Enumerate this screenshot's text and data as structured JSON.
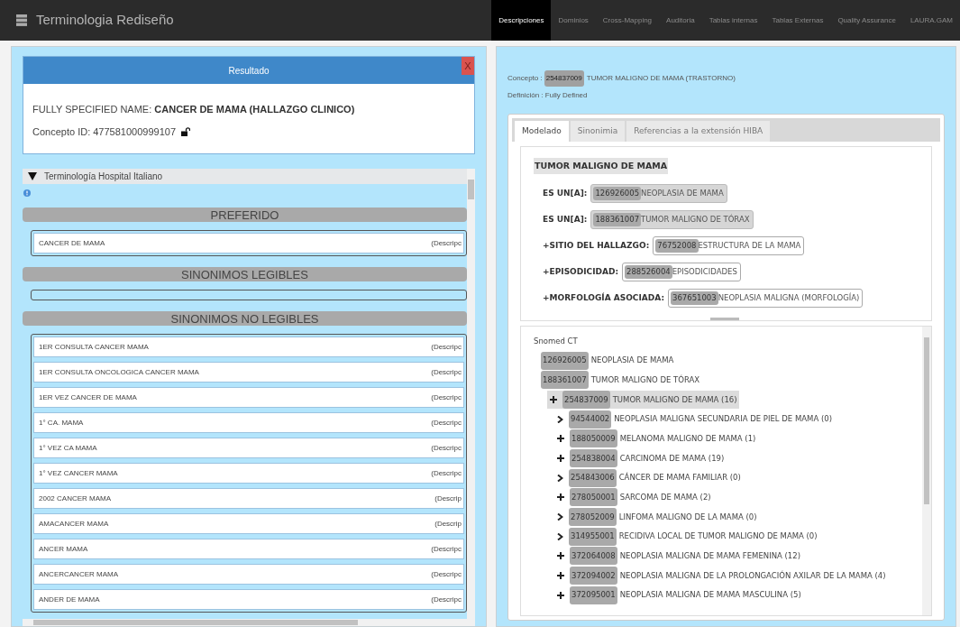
{
  "app": {
    "title": "Terminologia Rediseño"
  },
  "nav": [
    {
      "label": "Descripciones",
      "selected": true
    },
    {
      "label": "Dominios",
      "selected": false
    },
    {
      "label": "Cross-Mapping",
      "selected": false
    },
    {
      "label": "Auditoria",
      "selected": false
    },
    {
      "label": "Tablas internas",
      "selected": false
    },
    {
      "label": "Tablas Externas",
      "selected": false
    },
    {
      "label": "Quality Assurance",
      "selected": false
    },
    {
      "label": "LAURA.GAM",
      "selected": false
    }
  ],
  "result": {
    "title": "Resultado",
    "close": "X",
    "fsn_label": "FULLY SPECIFIED NAME:",
    "fsn": "CANCER DE MAMA (HALLAZGO CLINICO)",
    "concept_id": "Concepto ID: 477581000999107",
    "locked": false
  },
  "terminology": {
    "title": "Terminología Hospital Italiano",
    "expanded": true,
    "sections": [
      {
        "title": "PREFERIDO",
        "rows": [
          {
            "text": "CANCER DE MAMA",
            "type": "(Descripc"
          }
        ]
      },
      {
        "title": "SINONIMOS LEGIBLES"
      },
      {
        "title": "SINONIMOS NO LEGIBLES",
        "rows": [
          {
            "text": "1ER CONSULTA CANCER MAMA",
            "type": "(Descripc"
          },
          {
            "text": "1ER CONSULTA ONCOLOGICA CANCER MAMA",
            "type": "(Descripc"
          },
          {
            "text": "1ER VEZ CANCER DE MAMA",
            "type": "(Descripc"
          },
          {
            "text": "1° CA. MAMA",
            "type": "(Descripc"
          },
          {
            "text": "1° VEZ CA MAMA",
            "type": "(Descripc"
          },
          {
            "text": "1° VEZ CANCER MAMA",
            "type": "(Descripc"
          },
          {
            "text": "2002 CANCER MAMA",
            "type": "(Descrip"
          },
          {
            "text": "AMACANCER MAMA",
            "type": "(Descrip"
          },
          {
            "text": "ANCER MAMA",
            "type": "(Descripc"
          },
          {
            "text": "ANCERCANCER MAMA",
            "type": "(Descripc"
          },
          {
            "text": "ANDER DE MAMA",
            "type": "(Descripc"
          }
        ]
      }
    ]
  },
  "concept": {
    "label": "Concepto :",
    "id": "254837009",
    "name": "TUMOR MALIGNO DE MAMA (TRASTORNO)",
    "definition": "Definición : Fully Defined"
  },
  "tabs": [
    {
      "label": "Modelado",
      "selected": true
    },
    {
      "label": "Sinonimia",
      "selected": false
    },
    {
      "label": "Referencias a la extensión HIBA",
      "selected": false
    }
  ],
  "model": {
    "title": "TUMOR MALIGNO DE MAMA",
    "relations": [
      {
        "kind": "isa",
        "label": "ES UN[A]:",
        "id": "126926005",
        "name": "NEOPLASIA DE MAMA"
      },
      {
        "kind": "isa",
        "label": "ES UN[A]:",
        "id": "188361007",
        "name": "TUMOR MALIGNO DE TÓRAX"
      },
      {
        "kind": "attribute",
        "label": "+SITIO DEL HALLAZGO:",
        "id": "76752008",
        "name": "ESTRUCTURA DE LA MAMA"
      },
      {
        "kind": "attribute",
        "label": "+EPISODICIDAD:",
        "id": "288526004",
        "name": "EPISODICIDADES"
      },
      {
        "kind": "attribute",
        "label": "+MORFOLOGÍA ASOCIADA:",
        "id": "367651003",
        "name": "NEOPLASIA MALIGNA (MORFOLOGÍA)"
      }
    ]
  },
  "hierarchy": {
    "title": "Snomed CT",
    "nodes": [
      {
        "id": "126926005",
        "name": "NEOPLASIA DE MAMA"
      },
      {
        "id": "188361007",
        "name": "TUMOR MALIGNO DE TÓRAX",
        "children": [
          {
            "kind": "plus",
            "id": "254837009",
            "name": "TUMOR MALIGNO DE MAMA (16)",
            "selected": true,
            "children": [
              {
                "kind": "chevron",
                "id": "94544002",
                "name": "NEOPLASIA MALIGNA SECUNDARIA DE PIEL DE MAMA (0)",
                "selected": false
              },
              {
                "kind": "plus",
                "id": "188050009",
                "name": "MELANOMA MALIGNO DE MAMA (1)",
                "selected": false
              },
              {
                "kind": "plus",
                "id": "254838004",
                "name": "CARCINOMA DE MAMA (19)",
                "selected": false
              },
              {
                "kind": "chevron",
                "id": "254843006",
                "name": "CÁNCER DE MAMA FAMILIAR (0)",
                "selected": false
              },
              {
                "kind": "plus",
                "id": "278050001",
                "name": "SARCOMA DE MAMA (2)",
                "selected": false
              },
              {
                "kind": "chevron",
                "id": "278052009",
                "name": "LINFOMA MALIGNO DE LA MAMA (0)",
                "selected": false
              },
              {
                "kind": "chevron",
                "id": "314955001",
                "name": "RECIDIVA LOCAL DE TUMOR MALIGNO DE MAMA (0)",
                "selected": false
              },
              {
                "kind": "plus",
                "id": "372064008",
                "name": "NEOPLASIA MALIGNA DE MAMA FEMENINA (12)",
                "selected": false
              },
              {
                "kind": "plus",
                "id": "372094002",
                "name": "NEOPLASIA MALIGNA DE LA PROLONGACIÓN AXILAR DE LA MAMA (4)",
                "selected": false
              },
              {
                "kind": "plus",
                "id": "372095001",
                "name": "NEOPLASIA MALIGNA DE MAMA MASCULINA (5)",
                "selected": false
              }
            ]
          }
        ]
      }
    ]
  }
}
